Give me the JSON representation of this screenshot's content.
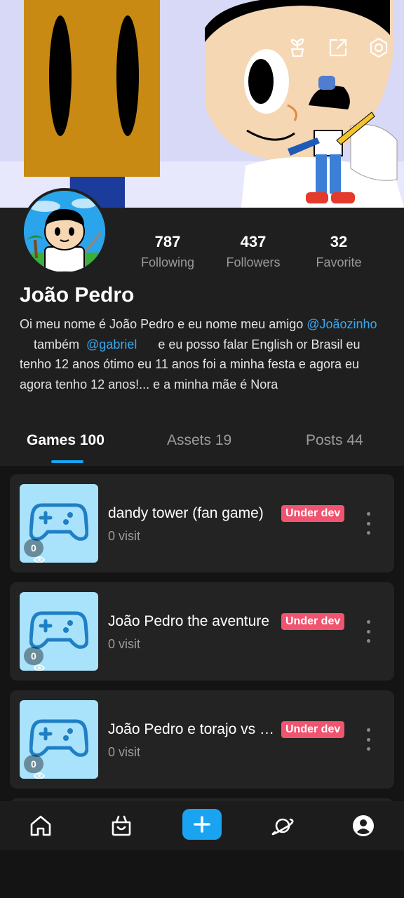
{
  "profile": {
    "name": "João Pedro",
    "stats": [
      {
        "value": "787",
        "label": "Following"
      },
      {
        "value": "437",
        "label": "Followers"
      },
      {
        "value": "32",
        "label": "Favorite"
      }
    ],
    "bio": {
      "part1": "Oi meu nome é João Pedro e eu nome meu amigo ",
      "mention1": "@Joãozinho",
      "part2": "    também  ",
      "mention2": "@gabriel",
      "part3": "      e eu posso falar English or Brasil eu tenho 12 anos ótimo eu 11 anos foi a minha festa e agora eu agora tenho 12 anos!... e a minha mãe é Nora"
    }
  },
  "tabs": [
    {
      "label": "Games 100",
      "active": true
    },
    {
      "label": "Assets 19",
      "active": false
    },
    {
      "label": "Posts 44",
      "active": false
    }
  ],
  "games": [
    {
      "title": "dandy tower (fan game)",
      "visits": "0 visit",
      "views": "0",
      "badge": "Under dev"
    },
    {
      "title": "João Pedro the aventure",
      "visits": "0 visit",
      "views": "0",
      "badge": "Under dev"
    },
    {
      "title": "João Pedro e torajo vs mario",
      "visits": "0 visit",
      "views": "0",
      "badge": "Under dev"
    }
  ],
  "icons": {
    "banner_actions": [
      "plant-icon",
      "share-icon",
      "settings-icon"
    ],
    "nav": [
      "home-icon",
      "shop-icon",
      "create-icon",
      "planet-icon",
      "profile-icon"
    ]
  },
  "colors": {
    "accent": "#1aa3f0",
    "badge": "#f0546f",
    "mention": "#39a8f0",
    "thumb": "#a9e2fb"
  }
}
